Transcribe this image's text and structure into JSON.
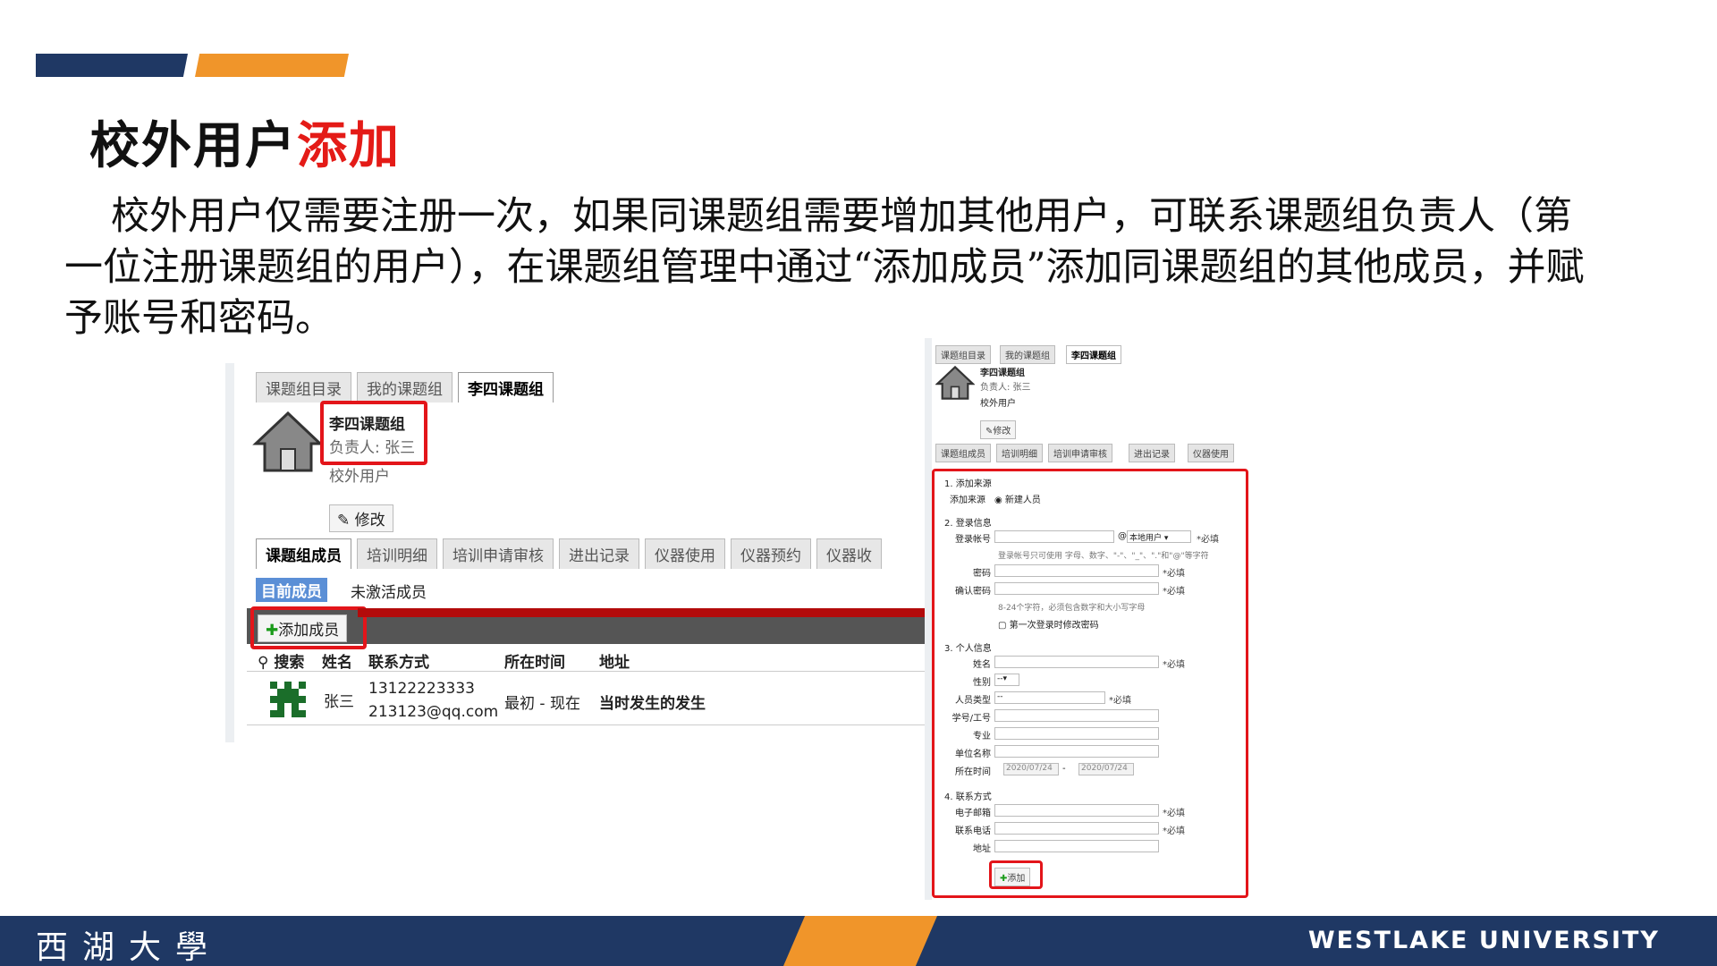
{
  "slide": {
    "title_main": "校外用户",
    "title_highlight": "添加",
    "intro": "校外用户仅需要注册一次，如果同课题组需要增加其他用户，可联系课题组负责人（第一位注册课题组的用户），在课题组管理中通过“添加成员”添加同课题组的其他成员，并赋予账号和密码。"
  },
  "left_shot": {
    "top_tabs": [
      "课题组目录",
      "我的课题组",
      "李四课题组"
    ],
    "group_name": "李四课题组",
    "owner": "负责人: 张三",
    "user_type": "校外用户",
    "edit_button": "修改",
    "sub_tabs": [
      "课题组成员",
      "培训明细",
      "培训申请审核",
      "进出记录",
      "仪器使用",
      "仪器预约",
      "仪器收"
    ],
    "member_tabs": [
      "目前成员",
      "未激活成员"
    ],
    "add_button": "添加成员",
    "table_headers": [
      "搜索",
      "姓名",
      "联系方式",
      "所在时间",
      "地址"
    ],
    "row": {
      "name": "张三",
      "phone": "13122223333",
      "email": "213123@qq.com",
      "time": "最初 - 现在",
      "address": "当时发生的发生"
    }
  },
  "right_shot": {
    "top_tabs": [
      "课题组目录",
      "我的课题组",
      "李四课题组"
    ],
    "group_name": "李四课题组",
    "owner": "负责人: 张三",
    "user_type": "校外用户",
    "edit_button": "修改",
    "sub_tabs": [
      "课题组成员",
      "培训明细",
      "培训申请审核",
      "进出记录",
      "仪器使用"
    ],
    "section1": "1. 添加来源",
    "source_label": "添加来源",
    "source_value": "新建人员",
    "section2": "2. 登录信息",
    "login_label": "登录帐号",
    "at_sign": "@",
    "login_domain": "本地用户",
    "required": "*必填",
    "login_hint": "登录帐号只可使用 字母、数字、\"-\"、\"_\"、\".\"和\"@\"等字符",
    "password_label": "密码",
    "confirm_label": "确认密码",
    "password_hint": "8-24个字符，必须包含数字和大小写字母",
    "first_login": "第一次登录时修改密码",
    "section3": "3. 个人信息",
    "name_label": "姓名",
    "gender_label": "性别",
    "gender_value": "--",
    "type_label": "人员类型",
    "type_value": "--",
    "id_label": "学号/工号",
    "major_label": "专业",
    "org_label": "单位名称",
    "time_label": "所在时间",
    "date_from": "2020/07/24",
    "date_sep": "-",
    "date_to": "2020/07/24",
    "section4": "4. 联系方式",
    "email_label": "电子邮箱",
    "phone_label": "联系电话",
    "address_label": "地址",
    "add_button": "添加"
  },
  "footer": {
    "left": "西湖大學",
    "right": "WESTLAKE UNIVERSITY"
  },
  "colors": {
    "navy": "#1f3864",
    "orange": "#f0952a",
    "red": "#e3151a",
    "dark_red": "#b30b0b"
  }
}
